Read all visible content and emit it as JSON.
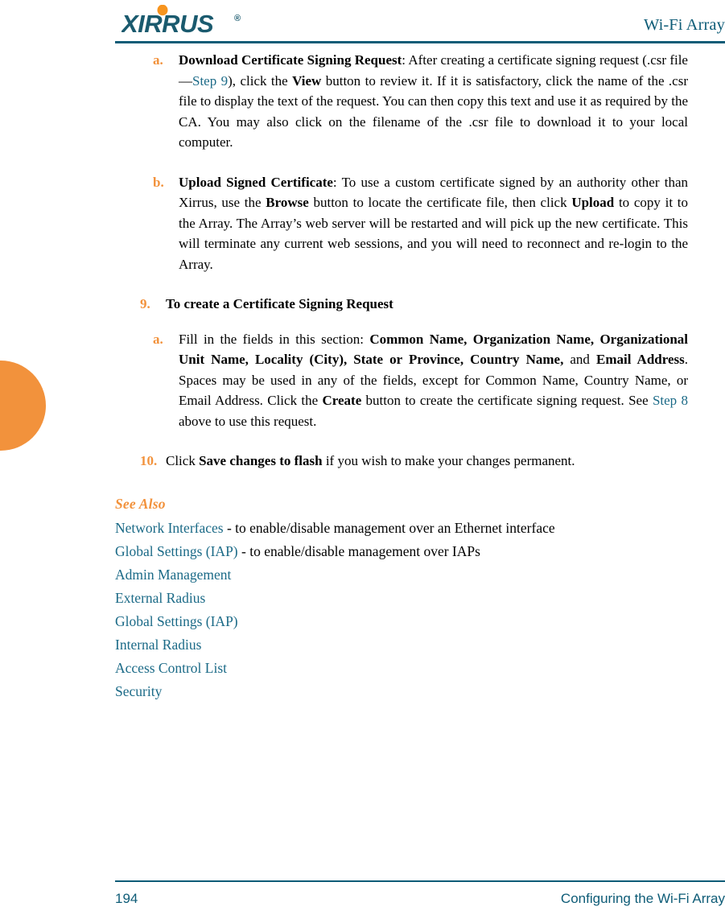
{
  "header": {
    "logo_text": "XIRRUS",
    "logo_trademark": "®",
    "title": "Wi-Fi Array",
    "rule_color": "#0E5C77",
    "logo_color": "#1A5A6E",
    "logo_dot_color": "#F2923C"
  },
  "accent": {
    "orange": "#F2923C",
    "teal": "#0E5C77",
    "link": "#1B6A87"
  },
  "thumb_tab": {
    "name": "chapter-thumb-tab",
    "color": "#F2923C"
  },
  "content": {
    "item_a": {
      "marker": "a.",
      "lead": "Download Certificate Signing Request",
      "t1": ": After creating a certificate signing request (.csr file—",
      "link1": "Step 9",
      "t2": "), click the ",
      "b1": "View",
      "t3": " button to review it. If it is satisfactory, click the name of the .csr file to display the text of the request. You can then copy this text and use it as required by the CA. You may also click on the filename of the .csr file to download it to your local computer."
    },
    "item_b": {
      "marker": "b.",
      "lead": "Upload Signed Certificate",
      "t1": ": To use a custom certificate signed by an authority other than Xirrus, use the ",
      "b1": "Browse",
      "t2": " button to locate the certificate file, then click ",
      "b2": "Upload",
      "t3": " to copy it to the Array. The Array’s web server will be restarted and will pick up the new certificate. This will terminate any current web sessions, and you will need to reconnect and re-login to the Array."
    },
    "item_9": {
      "marker": "9.",
      "heading": "To create a Certificate Signing Request"
    },
    "item_9a": {
      "marker": "a.",
      "t1": "Fill in the fields in this section: ",
      "b1": "Common Name, Organization Name, Organizational Unit Name, Locality (City), State or Province, Country Name,",
      "t2": " and ",
      "b2": "Email Address",
      "t3": ". Spaces may be used in any of the fields, except for Common Name, Country Name, or Email Address. Click the ",
      "b3": "Create",
      "t4": " button to create the certificate signing request. See ",
      "link1": "Step 8",
      "t5": " above to use this request."
    },
    "item_10": {
      "marker": "10.",
      "t1": "Click ",
      "b1": "Save changes to flash",
      "t2": " if you wish to make your changes permanent."
    }
  },
  "see_also": {
    "heading": "See Also",
    "links": [
      {
        "label": "Network Interfaces",
        "tail": " - to enable/disable management over an Ethernet interface"
      },
      {
        "label": "Global Settings (IAP)",
        "tail": " - to enable/disable management over IAPs"
      },
      {
        "label": "Admin Management",
        "tail": ""
      },
      {
        "label": "External Radius",
        "tail": ""
      },
      {
        "label": "Global Settings (IAP)",
        "tail": ""
      },
      {
        "label": "Internal Radius",
        "tail": ""
      },
      {
        "label": "Access Control List",
        "tail": ""
      },
      {
        "label": "Security",
        "tail": ""
      }
    ]
  },
  "footer": {
    "page_number": "194",
    "section": "Configuring the Wi-Fi Array"
  }
}
